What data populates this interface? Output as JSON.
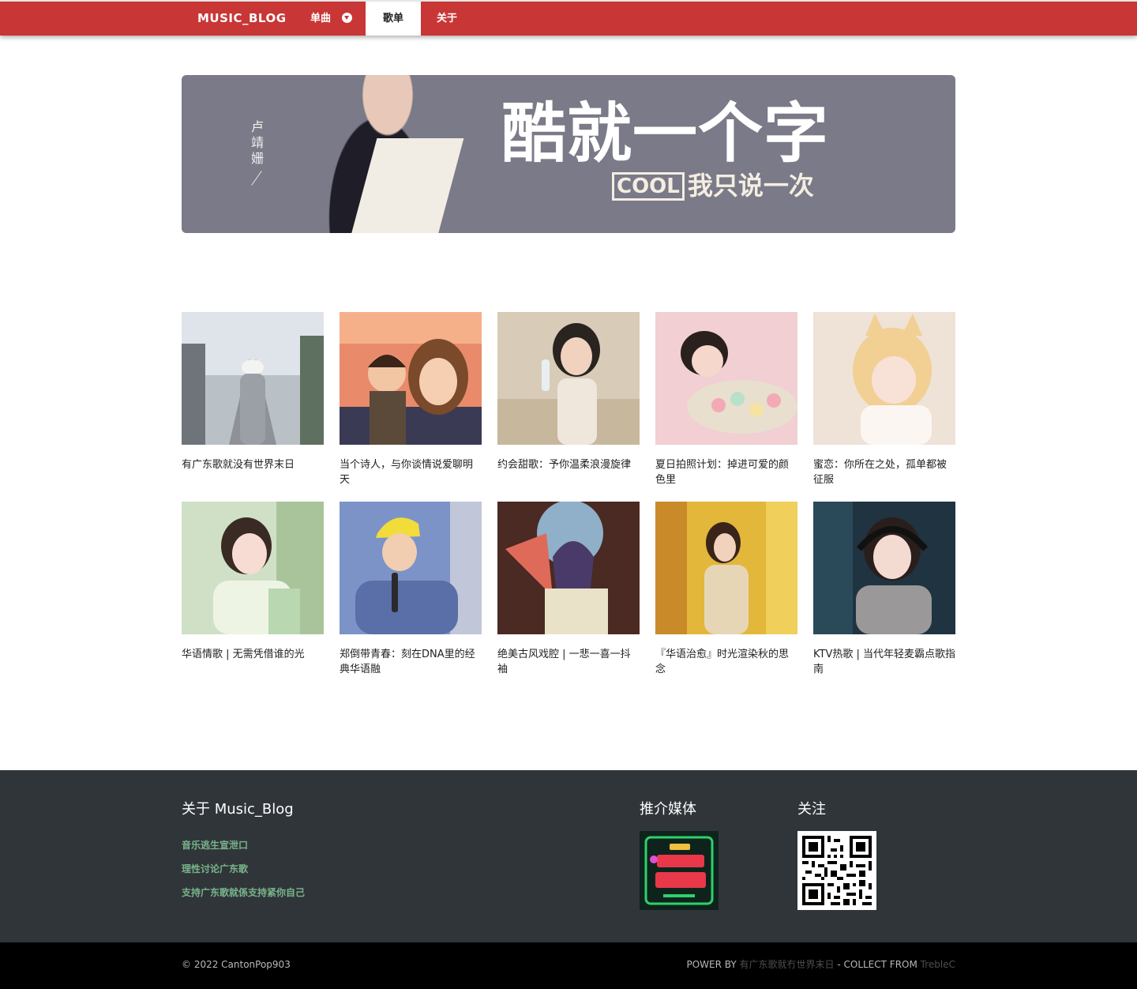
{
  "nav": {
    "brand": "MUSIC_BLOG",
    "items": [
      {
        "label": "单曲"
      },
      {
        "label": "歌单"
      },
      {
        "label": "关于"
      }
    ]
  },
  "banner": {
    "side_text": "卢靖姗",
    "headline": "酷就一个字",
    "cool_word": "COOL",
    "subline": "我只说一次"
  },
  "playlists": [
    {
      "title": "有广东歌就没有世界末日"
    },
    {
      "title": "当个诗人，与你谈情说爱聊明天"
    },
    {
      "title": "约会甜歌：予你温柔浪漫旋律"
    },
    {
      "title": "夏日拍照计划：掉进可爱的颜色里"
    },
    {
      "title": "蜜恋：你所在之处，孤单都被征服"
    },
    {
      "title": "华语情歌 | 无需凭借谁的光"
    },
    {
      "title": "郑倒带青春：刻在DNA里的经典华语融"
    },
    {
      "title": "绝美古风戏腔 | 一悲一喜一抖袖"
    },
    {
      "title": "『华语治愈』时光渲染秋的思念"
    },
    {
      "title": "KTV热歌 | 当代年轻麦霸点歌指南"
    }
  ],
  "footer": {
    "about_title": "关于 Music_Blog",
    "links": [
      "音乐逃生宣泄口",
      "理性讨论广东歌",
      "支持广东歌就係支持紧你自己"
    ],
    "media_title": "推介媒体",
    "follow_title": "关注",
    "copyright": "© 2022 CantonPop903",
    "power_prefix": "POWER BY ",
    "power_site": "有广东歌就冇世界末日",
    "collect_prefix": " - COLLECT FROM ",
    "collect_site": "TrebleC"
  },
  "colors": {
    "nav_bg": "#c83636",
    "footer_bg": "#30353a",
    "link_green": "#79b48a"
  }
}
